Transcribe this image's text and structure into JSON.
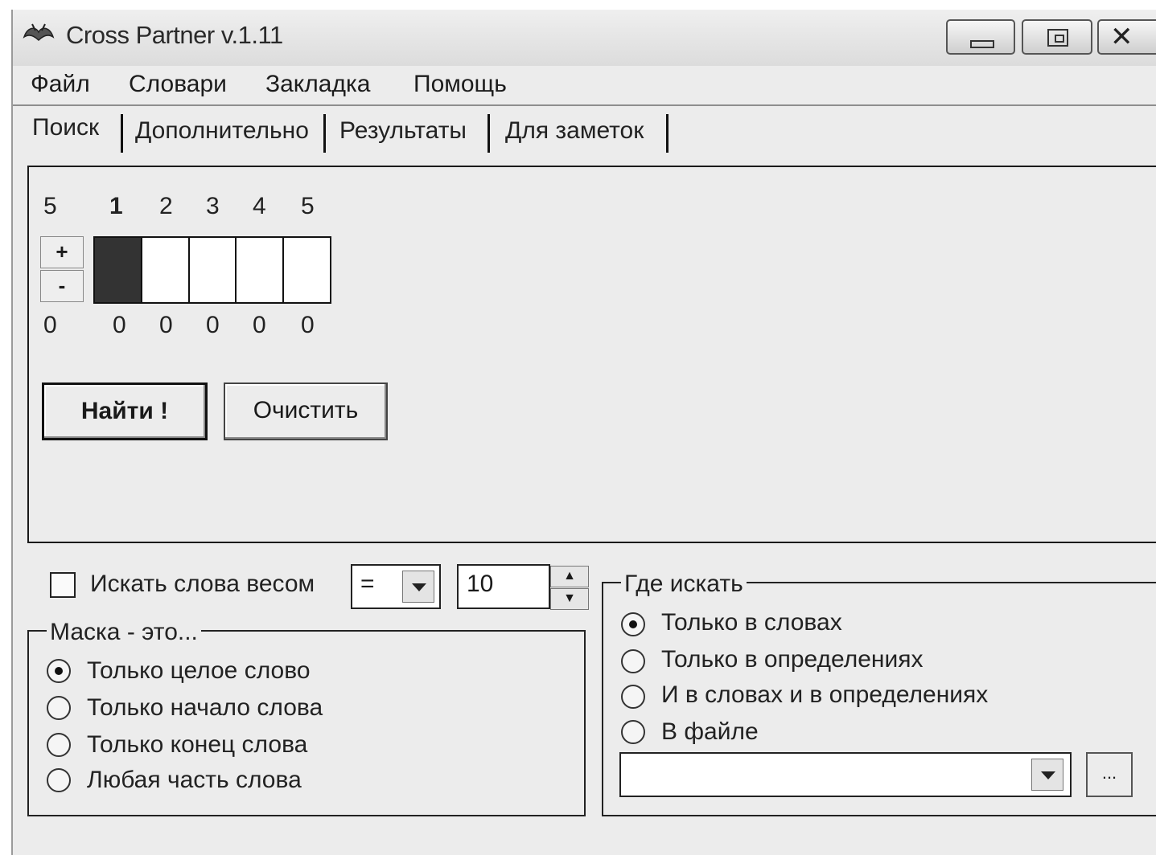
{
  "window": {
    "title": "Cross Partner v.1.11",
    "controls": {
      "minimize": "minimize",
      "maximize": "maximize",
      "close": "close"
    }
  },
  "menu": {
    "items": [
      "Файл",
      "Словари",
      "Закладка",
      "Помощь"
    ]
  },
  "tabs": {
    "items": [
      "Поиск",
      "Дополнительно",
      "Результаты",
      "Для заметок"
    ],
    "active": "Поиск"
  },
  "search": {
    "length_top": "5",
    "length_bottom": "0",
    "positions": [
      "1",
      "2",
      "3",
      "4",
      "5"
    ],
    "position_counts": [
      "0",
      "0",
      "0",
      "0",
      "0"
    ],
    "plus_label": "+",
    "minus_label": "-",
    "find_label": "Найти !",
    "clear_label": "Очистить"
  },
  "weight": {
    "checkbox_label": "Искать слова весом",
    "checked": false,
    "operator": "=",
    "value": "10",
    "spin_up": "▲",
    "spin_down": "▼"
  },
  "mask": {
    "title": "Маска - это...",
    "options": [
      "Только целое слово",
      "Только начало слова",
      "Только конец слова",
      "Любая часть слова"
    ],
    "selected": 0
  },
  "where": {
    "title": "Где искать",
    "options": [
      "Только в словах",
      "Только в определениях",
      "И в словах и в определениях",
      "В файле"
    ],
    "selected": 0,
    "file_value": "",
    "browse_label": "..."
  }
}
